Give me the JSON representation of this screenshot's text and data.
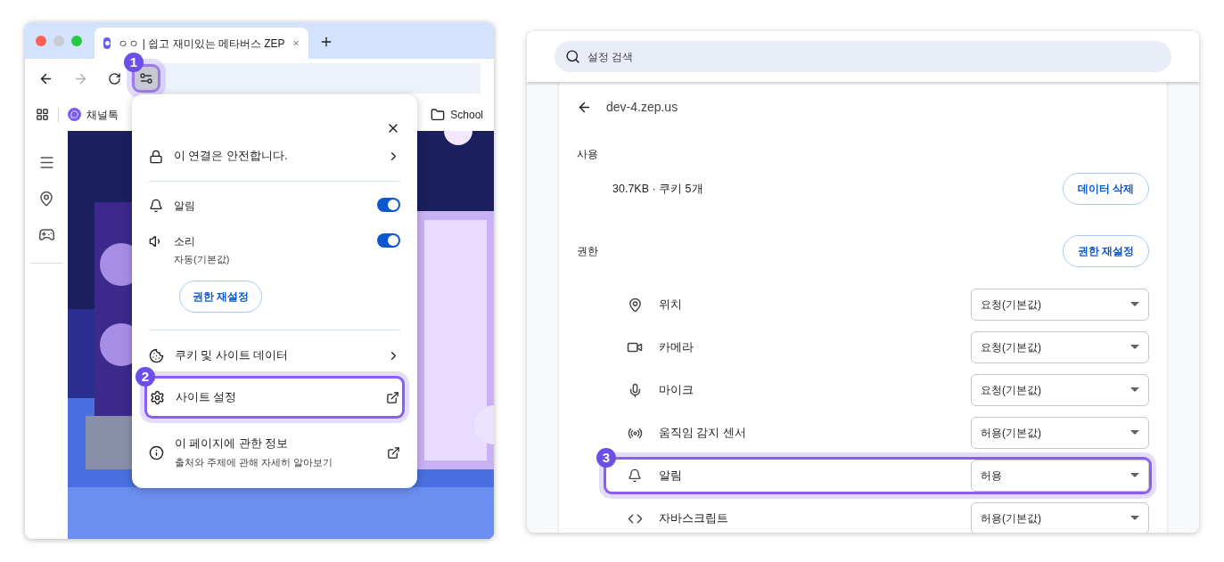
{
  "browser": {
    "tab": {
      "title": "ㅇㅇ | 쉽고 재미있는 메타버스 ZEP"
    },
    "site_info_button": {
      "badge": "1",
      "highlighted": true
    },
    "bookmarks": [
      {
        "kind": "channel",
        "label": "채널톡"
      },
      {
        "kind": "folder",
        "label": "School"
      }
    ],
    "site_popup": {
      "connection": "이 연결은 안전합니다.",
      "permissions": [
        {
          "kind": "bell",
          "label": "알림",
          "on": true
        },
        {
          "kind": "sound",
          "label": "소리",
          "sublabel": "자동(기본값)",
          "on": true
        }
      ],
      "reset_button": "권한 재설정",
      "links": [
        {
          "kind": "cookie",
          "label": "쿠키 및 사이트 데이터",
          "highlighted": false
        },
        {
          "kind": "settings",
          "label": "사이트 설정",
          "highlighted": true,
          "badge": "2"
        },
        {
          "kind": "info",
          "label": "이 페이지에 관한 정보",
          "sublabel": "출처와 주제에 관해 자세히 알아보기",
          "highlighted": false
        }
      ]
    }
  },
  "settings": {
    "search": {
      "placeholder": "설정 검색"
    },
    "site": "dev-4.zep.us",
    "usage": {
      "heading": "사용",
      "summary": "30.7KB · 쿠키 5개",
      "button": "데이터 삭제"
    },
    "permissions": {
      "heading": "권한",
      "button": "권한 재설정",
      "rows": [
        {
          "kind": "location",
          "label": "위치",
          "value": "요청(기본값)",
          "highlighted": false
        },
        {
          "kind": "camera",
          "label": "카메라",
          "value": "요청(기본값)",
          "highlighted": false
        },
        {
          "kind": "mic",
          "label": "마이크",
          "value": "요청(기본값)",
          "highlighted": false
        },
        {
          "kind": "sensor",
          "label": "움직임 감지 센서",
          "value": "허용(기본값)",
          "highlighted": false
        },
        {
          "kind": "bell",
          "label": "알림",
          "value": "허용",
          "highlighted": true,
          "badge": "3"
        },
        {
          "kind": "code",
          "label": "자바스크립트",
          "value": "허용(기본값)",
          "highlighted": false
        }
      ]
    }
  }
}
